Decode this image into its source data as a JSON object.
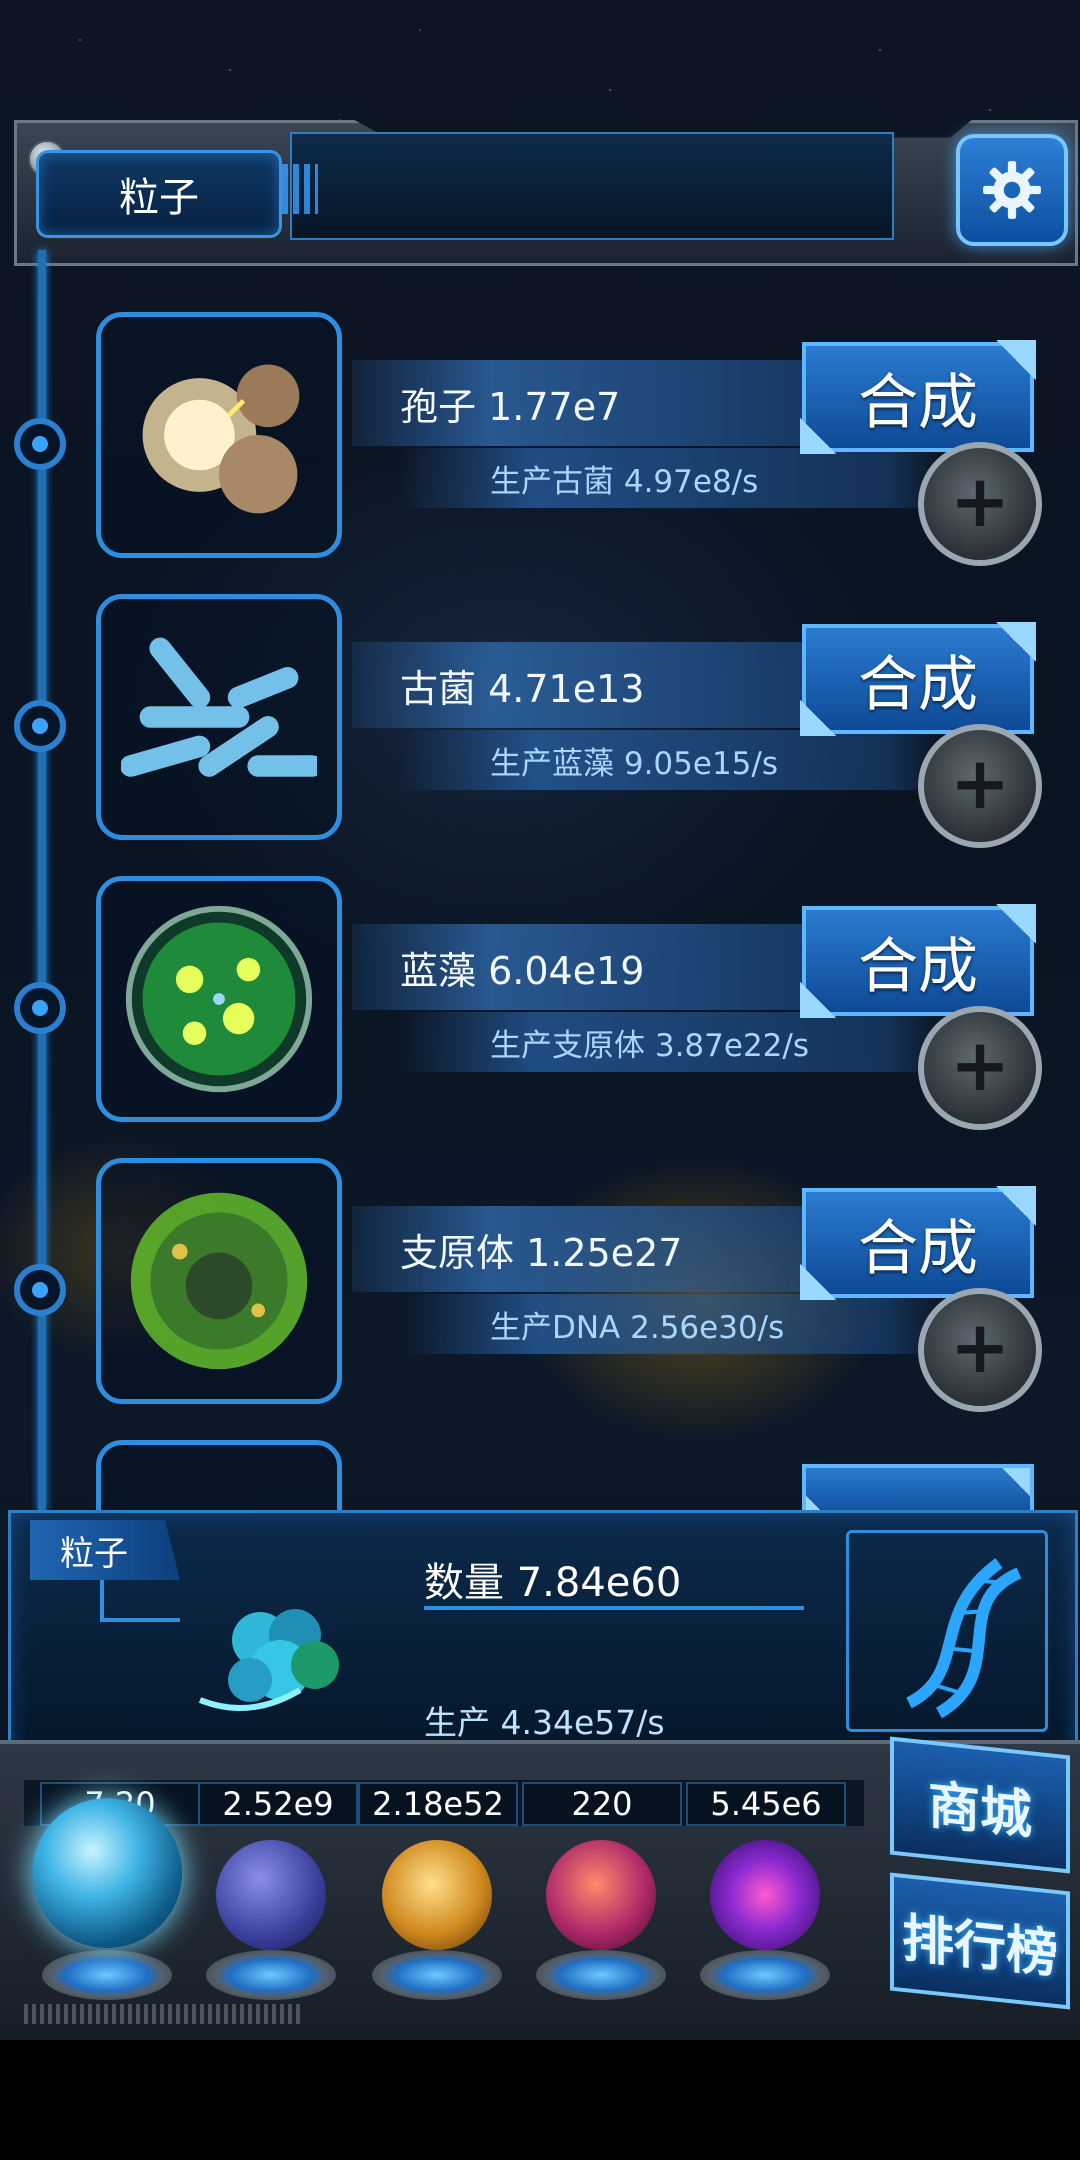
{
  "header": {
    "title": "粒子",
    "settings_icon": "gear-icon"
  },
  "rows": [
    {
      "name_text": "孢子 1.77e7",
      "production_text": "生产古菌 4.97e8/s",
      "synth_label": "合成",
      "icon": "spore-icon"
    },
    {
      "name_text": "古菌 4.71e13",
      "production_text": "生产蓝藻 9.05e15/s",
      "synth_label": "合成",
      "icon": "archaea-icon"
    },
    {
      "name_text": "蓝藻 6.04e19",
      "production_text": "生产支原体 3.87e22/s",
      "synth_label": "合成",
      "icon": "cyanobacteria-icon"
    },
    {
      "name_text": "支原体 1.25e27",
      "production_text": "生产DNA 2.56e30/s",
      "synth_label": "合成",
      "icon": "mycoplasma-icon"
    }
  ],
  "info_panel": {
    "tag": "粒子",
    "count_text": "数量 7.84e60",
    "production_text": "生产 4.34e57/s",
    "icon": "dna-icon"
  },
  "tabs": [
    {
      "value": "7.20",
      "orb": "particle-orb",
      "active": true
    },
    {
      "value": "2.52e9",
      "orb": "lightning-orb"
    },
    {
      "value": "2.18e52",
      "orb": "galaxy-orb"
    },
    {
      "value": "220",
      "orb": "brain-orb"
    },
    {
      "value": "5.45e6",
      "orb": "vortex-orb"
    }
  ],
  "side_buttons": {
    "shop": "商城",
    "ranking": "排行榜"
  },
  "colors": {
    "accent": "#2d8ee0",
    "button": "#1f6fc4",
    "background": "#0a1422"
  }
}
